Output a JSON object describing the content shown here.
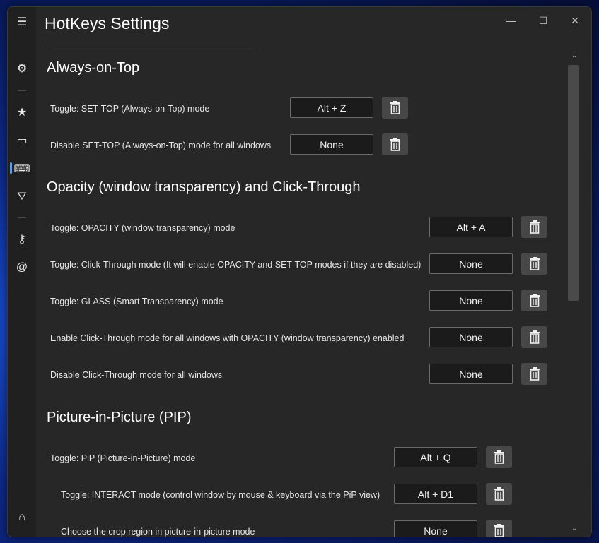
{
  "window": {
    "title": "HotKeys Settings",
    "minimize_glyph": "—",
    "maximize_glyph": "☐",
    "close_glyph": "✕"
  },
  "sidebar": {
    "items": [
      {
        "name": "menu-icon",
        "glyph": "☰"
      },
      {
        "name": "gear-icon",
        "glyph": "⚙"
      },
      {
        "name": "star-icon",
        "glyph": "★"
      },
      {
        "name": "toolbar-icon",
        "glyph": "▭"
      },
      {
        "name": "keyboard-icon",
        "glyph": "⌨"
      },
      {
        "name": "filter-icon",
        "glyph": "⛛"
      },
      {
        "name": "key-icon",
        "glyph": "⚷"
      },
      {
        "name": "at-icon",
        "glyph": "@"
      },
      {
        "name": "home-icon",
        "glyph": "⌂"
      }
    ]
  },
  "sections": [
    {
      "title": "Always-on-Top",
      "rows": [
        {
          "label": "Toggle: SET-TOP (Always-on-Top) mode",
          "hotkey": "Alt + Z"
        },
        {
          "label": "Disable SET-TOP (Always-on-Top) mode for all windows",
          "hotkey": "None"
        }
      ]
    },
    {
      "title": "Opacity (window transparency) and Click-Through",
      "rows": [
        {
          "label": "Toggle: OPACITY (window transparency) mode",
          "hotkey": "Alt + A"
        },
        {
          "label": "Toggle: Click-Through mode (It will enable OPACITY and SET-TOP modes if they are disabled)",
          "hotkey": "None"
        },
        {
          "label": "Toggle: GLASS (Smart Transparency) mode",
          "hotkey": "None"
        },
        {
          "label": "Enable Click-Through mode for all windows with OPACITY (window transparency) enabled",
          "hotkey": "None"
        },
        {
          "label": "Disable Click-Through mode for all windows",
          "hotkey": "None"
        }
      ]
    },
    {
      "title": "Picture-in-Picture (PIP)",
      "rows": [
        {
          "label": "Toggle: PiP (Picture-in-Picture) mode",
          "hotkey": "Alt + Q"
        },
        {
          "label": "Toggle: INTERACT mode (control window by mouse & keyboard via the PiP view)",
          "hotkey": "Alt + D1"
        },
        {
          "label": "Choose the crop region in picture-in-picture mode",
          "hotkey": "None"
        }
      ]
    }
  ],
  "scrollbar": {
    "up_glyph": "⌃",
    "down_glyph": "⌄"
  }
}
